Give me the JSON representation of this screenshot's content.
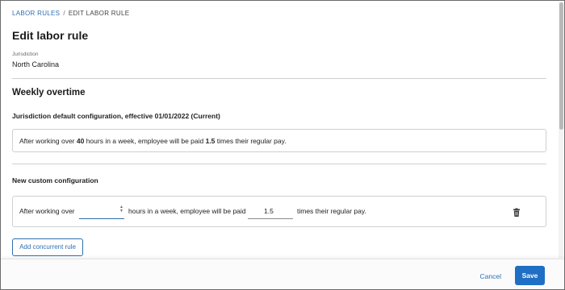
{
  "breadcrumb": {
    "parent": "LABOR RULES",
    "separator": "/",
    "current": "EDIT LABOR RULE"
  },
  "page": {
    "title": "Edit labor rule"
  },
  "jurisdiction": {
    "label": "Jurisdiction",
    "value": "North Carolina"
  },
  "weekly_overtime": {
    "title": "Weekly overtime",
    "default_heading": "Jurisdiction default configuration, effective 01/01/2022 (Current)",
    "default_rule": {
      "prefix": "After working over ",
      "hours": "40",
      "middle": " hours in a week, employee will be paid ",
      "multiplier": "1.5",
      "suffix": " times their regular pay."
    },
    "custom_heading": "New custom configuration",
    "custom_rule": {
      "prefix": "After working over",
      "hours_value": "",
      "middle": "hours in a week, employee will be paid",
      "multiplier_value": "1.5",
      "suffix": "times their regular pay."
    },
    "add_rule_label": "Add concurrent rule"
  },
  "footer": {
    "cancel_label": "Cancel",
    "save_label": "Save"
  },
  "icons": {
    "delete": "trash-icon",
    "stepper": "stepper-arrows-icon"
  },
  "colors": {
    "accent": "#1f6fc4",
    "link": "#2f6fb0"
  }
}
